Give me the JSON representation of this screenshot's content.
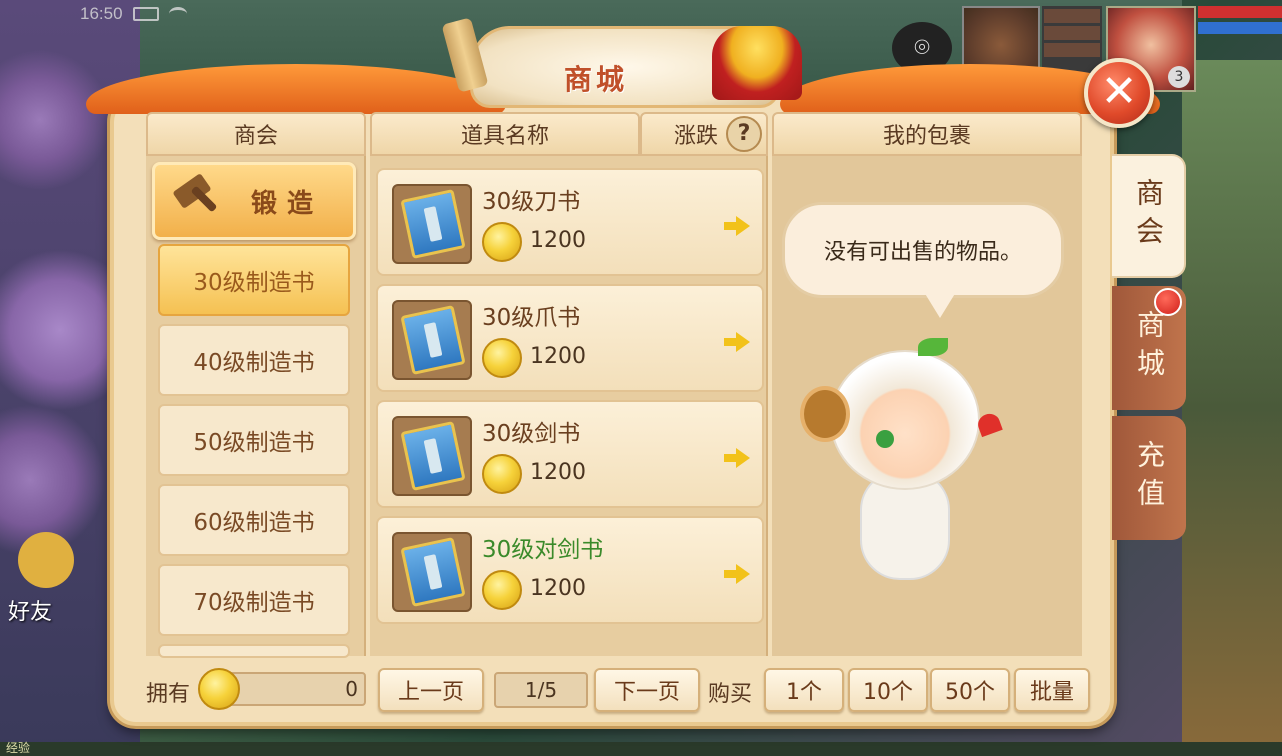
{
  "status_bar": {
    "time": "16:50"
  },
  "hud": {
    "player_level": "3",
    "friends_label": "好友",
    "exp_label": "经验"
  },
  "window": {
    "title": "商城"
  },
  "headers": {
    "guild": "商会",
    "item_name": "道具名称",
    "change": "涨跌",
    "help": "?",
    "bag": "我的包裹"
  },
  "categories": [
    {
      "label": "锻造"
    },
    {
      "label": "30级制造书"
    },
    {
      "label": "40级制造书"
    },
    {
      "label": "50级制造书"
    },
    {
      "label": "60级制造书"
    },
    {
      "label": "70级制造书"
    }
  ],
  "items": [
    {
      "name": "30级刀书",
      "price": "1200",
      "icon": "blade-scroll-icon"
    },
    {
      "name": "30级爪书",
      "price": "1200",
      "icon": "claw-scroll-icon"
    },
    {
      "name": "30级剑书",
      "price": "1200",
      "icon": "sword-scroll-icon"
    },
    {
      "name": "30级对剑书",
      "price": "1200",
      "icon": "dual-sword-scroll-icon"
    }
  ],
  "bag": {
    "empty_message": "没有可出售的物品。"
  },
  "side_tabs": [
    {
      "label": "商会"
    },
    {
      "label": "商城"
    },
    {
      "label": "充值"
    }
  ],
  "footer": {
    "own_label": "拥有",
    "own_value": "0",
    "prev_page": "上一页",
    "page": "1/5",
    "next_page": "下一页",
    "buy_label": "购买",
    "buy_1": "1个",
    "buy_10": "10个",
    "buy_50": "50个",
    "buy_batch": "批量"
  },
  "colors": {
    "panel_bg": "#f3dfb9",
    "accent_orange": "#f5c152",
    "close_red": "#e04a2a",
    "green_name": "#3a8a2a"
  }
}
